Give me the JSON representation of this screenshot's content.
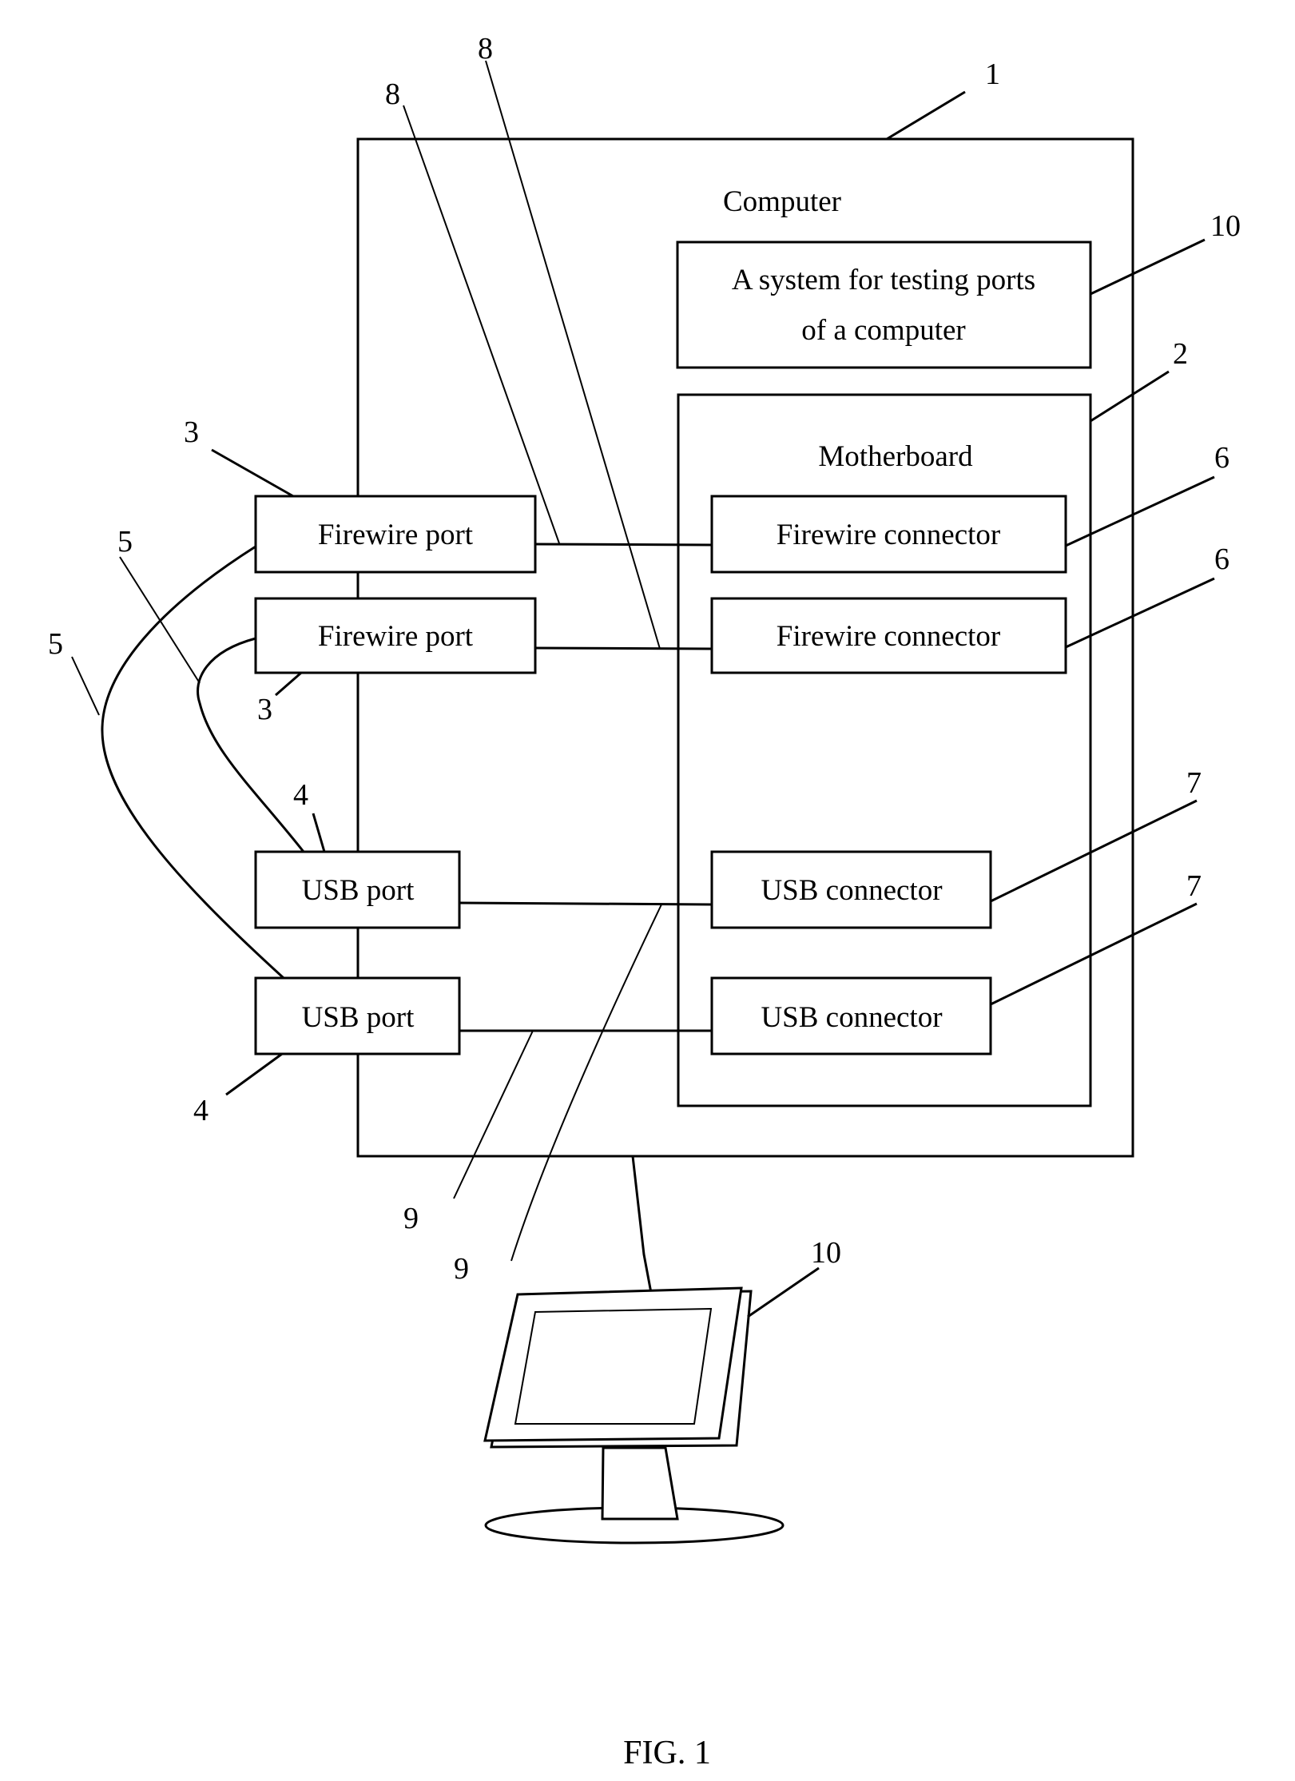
{
  "figure": {
    "caption": "FIG. 1",
    "computer": {
      "label": "Computer",
      "ref": "1"
    },
    "testing_system": {
      "line1": "A system for testing ports",
      "line2": "of a computer",
      "ref": "10"
    },
    "motherboard": {
      "label": "Motherboard",
      "ref": "2"
    },
    "firewire_ports": [
      {
        "label": "Firewire port",
        "ref": "3"
      },
      {
        "label": "Firewire port",
        "ref": "3"
      }
    ],
    "usb_ports": [
      {
        "label": "USB port",
        "ref": "4"
      },
      {
        "label": "USB port",
        "ref": "4"
      }
    ],
    "firewire_connectors": [
      {
        "label": "Firewire connector",
        "ref": "6"
      },
      {
        "label": "Firewire connector",
        "ref": "6"
      }
    ],
    "usb_connectors": [
      {
        "label": "USB connector",
        "ref": "7"
      },
      {
        "label": "USB connector",
        "ref": "7"
      }
    ],
    "cable_refs": [
      "5",
      "5"
    ],
    "firewire_link_refs": [
      "8",
      "8"
    ],
    "usb_link_refs": [
      "9",
      "9"
    ],
    "monitor": {
      "ref": "10"
    }
  }
}
